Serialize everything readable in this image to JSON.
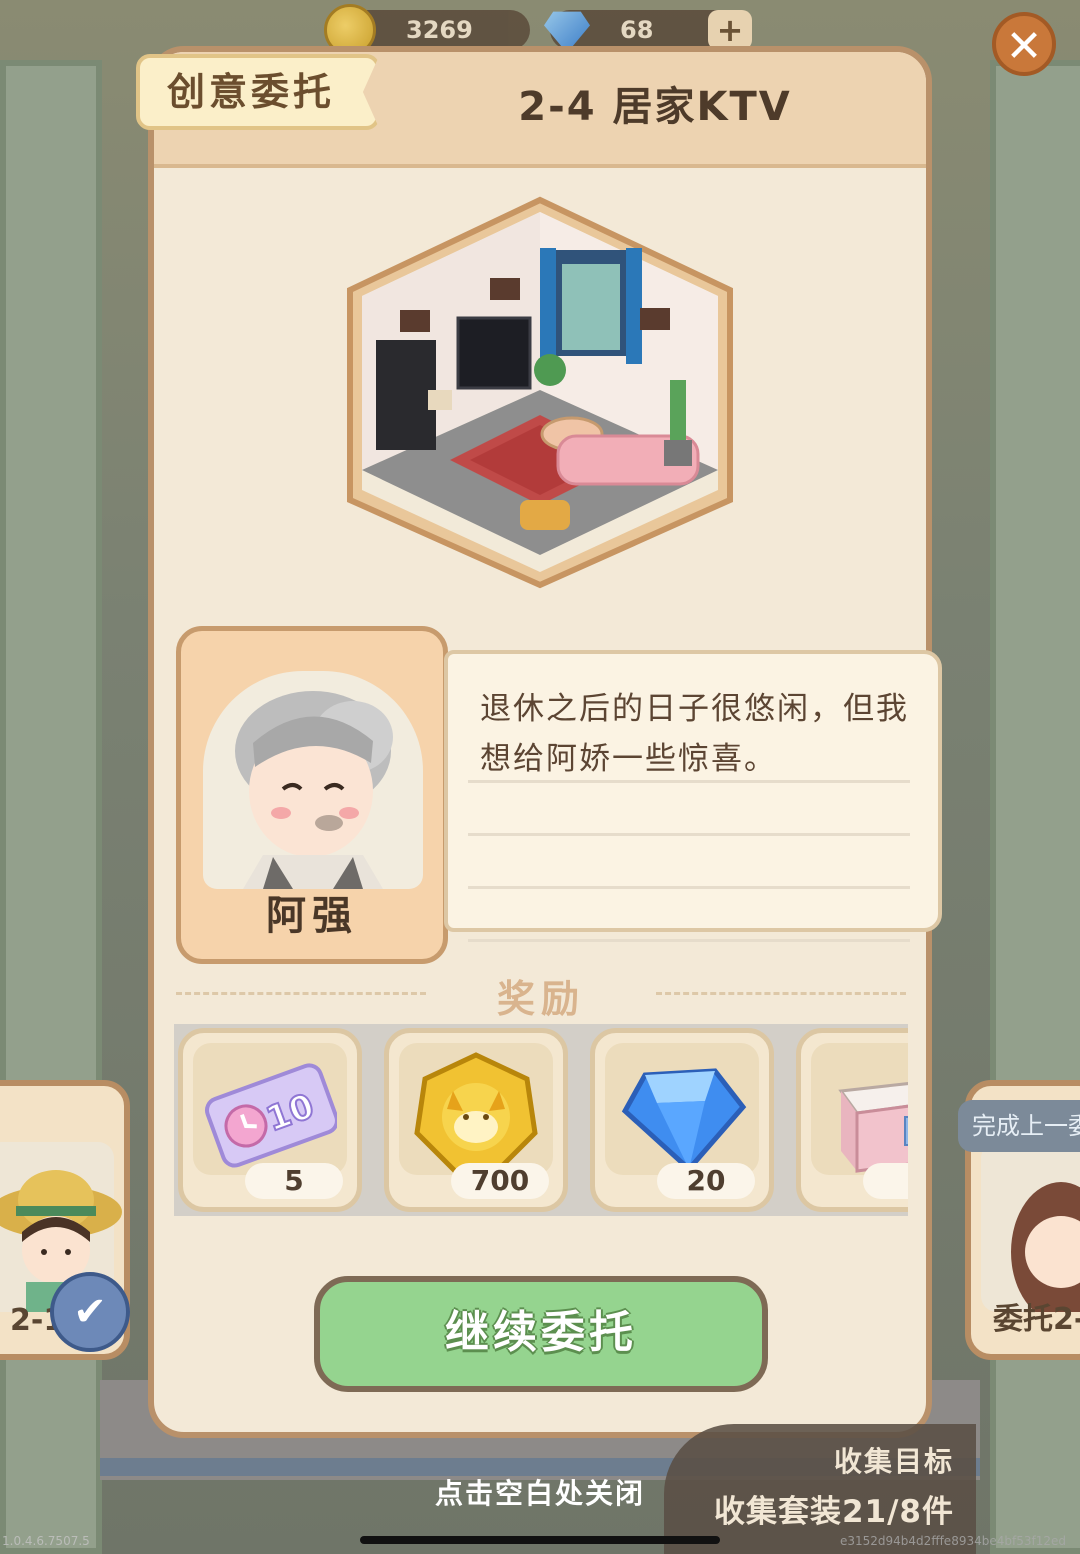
{
  "header": {
    "coins": "3269",
    "gems": "68",
    "add_label": "+",
    "close_label": "✕"
  },
  "panel": {
    "tab_label": "创意委托",
    "title": "2-4 居家KTV"
  },
  "npc": {
    "name": "阿强",
    "dialogue": "退休之后的日子很悠闲，但我想给阿娇一些惊喜。"
  },
  "rewards": {
    "title": "奖励",
    "items": [
      {
        "name": "speedup-ticket",
        "qty": "5"
      },
      {
        "name": "coin",
        "qty": "700"
      },
      {
        "name": "gem",
        "qty": "20"
      },
      {
        "name": "cabinet",
        "qty": ""
      }
    ]
  },
  "continue_button": "继续委托",
  "side": {
    "left_label": "2-1",
    "right_label": "委托2-",
    "right_tag": "完成上一委"
  },
  "goal": {
    "title": "收集目标",
    "text": "收集套装21/8件"
  },
  "close_hint": "点击空白处关闭",
  "version": "1.0.4.6.7507.5",
  "build_hash": "e3152d94b4d2fffe8934be4bf53f12ed"
}
